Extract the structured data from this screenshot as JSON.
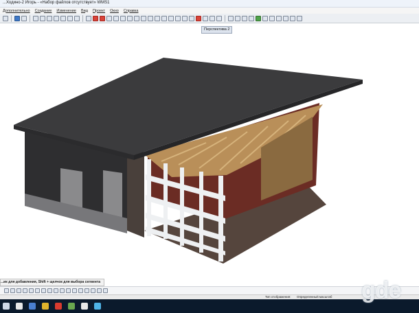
{
  "window": {
    "title": "...Ходино-2 Игорь - «Набор файлов отсутствует» WMS1"
  },
  "menu": [
    {
      "label": "Дополнительно"
    },
    {
      "label": "Создание"
    },
    {
      "label": "Изменение"
    },
    {
      "label": "Вид"
    },
    {
      "label": "Проект"
    },
    {
      "label": "Окно"
    },
    {
      "label": "Справка"
    }
  ],
  "view": {
    "tab_label": "Перспектива 2"
  },
  "hint": {
    "text": "...ик для добавления, Shift + щелчок для выбора сегмента"
  },
  "status": {
    "mode_label": "Тип отображения:",
    "mode_value": "Определенный масштаб"
  },
  "watermark": {
    "text": "gde"
  },
  "colors": {
    "roof": "#3b3b3d",
    "wall": "#2e2e30",
    "timber": "#b98f59",
    "railing": "#eef0f2",
    "floor": "#55453d",
    "taskbar": "#0b1a2c"
  }
}
